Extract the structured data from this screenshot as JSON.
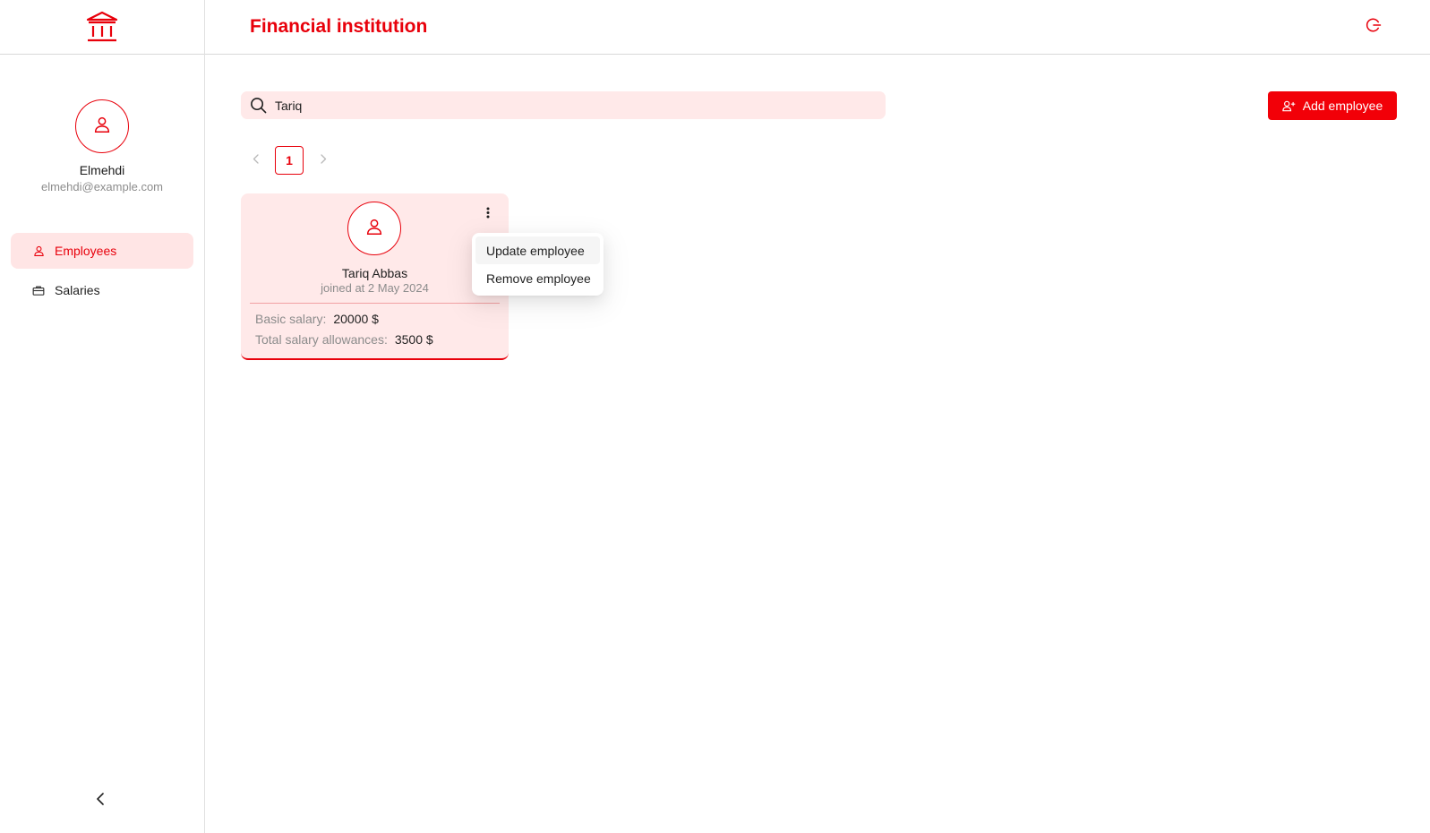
{
  "app": {
    "title": "Financial institution",
    "accent_color": "#e8000b",
    "logo_icon": "bank-icon",
    "logout_icon": "logout-icon"
  },
  "user": {
    "name": "Elmehdi",
    "email": "elmehdi@example.com"
  },
  "sidebar": {
    "items": [
      {
        "label": "Employees",
        "icon": "user-icon",
        "active": true
      },
      {
        "label": "Salaries",
        "icon": "briefcase-icon",
        "active": false
      }
    ],
    "collapse_icon": "chevron-left-icon"
  },
  "search": {
    "value": "Tariq",
    "placeholder": ""
  },
  "toolbar": {
    "add_label": "Add employee"
  },
  "pagination": {
    "current_page": "1"
  },
  "employees": [
    {
      "name": "Tariq Abbas",
      "joined": "joined at 2 May 2024",
      "basic_salary_label": "Basic salary",
      "basic_salary_value": "20000 $",
      "allowances_label": "Total salary allowances",
      "allowances_value": "3500 $"
    }
  ],
  "card_menu": {
    "items": [
      "Update employee",
      "Remove employee"
    ]
  }
}
